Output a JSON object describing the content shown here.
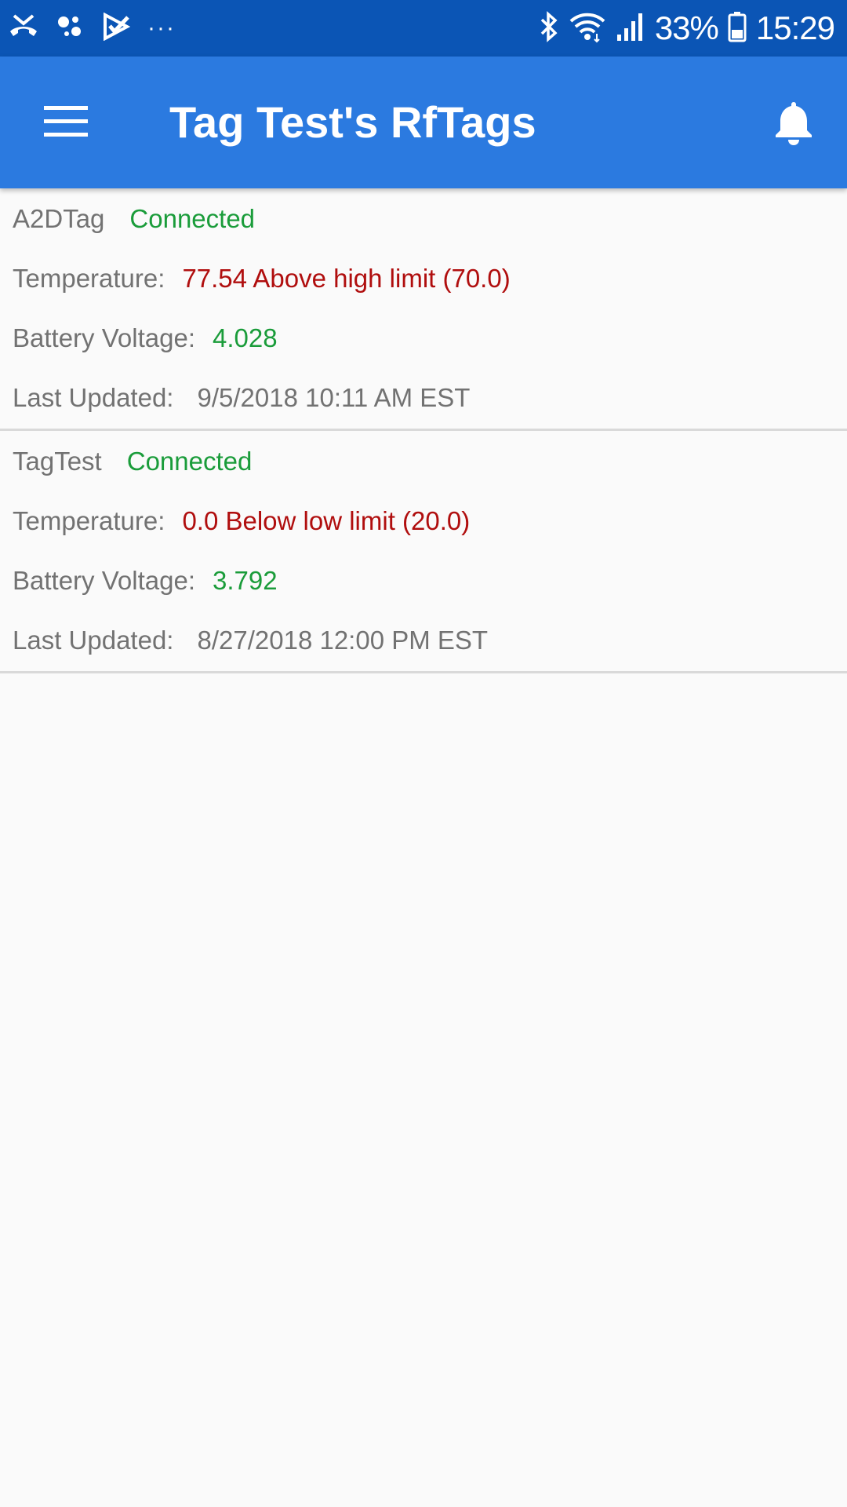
{
  "status_bar": {
    "battery_percent": "33%",
    "time": "15:29",
    "more": "···",
    "icons": [
      "missed-call-icon",
      "assistant-icon",
      "checkmark-app-icon",
      "bluetooth-icon",
      "wifi-icon",
      "signal-icon",
      "battery-icon"
    ]
  },
  "app_bar": {
    "title": "Tag Test's RfTags",
    "menu_icon": "menu-icon",
    "notification_icon": "bell-icon"
  },
  "colors": {
    "status_bar": "#0b55b5",
    "app_bar": "#2b7ae0",
    "ok": "#1a9c3a",
    "alert": "#b00e0e",
    "text": "#727272"
  },
  "tags": [
    {
      "name": "A2DTag",
      "status": "Connected",
      "temperature_label": "Temperature:",
      "temperature_value": "77.54 Above high limit (70.0)",
      "battery_label": "Battery Voltage:",
      "battery_value": "4.028",
      "updated_label": "Last Updated:",
      "updated_value": "9/5/2018 10:11 AM EST"
    },
    {
      "name": "TagTest",
      "status": "Connected",
      "temperature_label": "Temperature:",
      "temperature_value": "0.0 Below low limit (20.0)",
      "battery_label": "Battery Voltage:",
      "battery_value": "3.792",
      "updated_label": "Last Updated:",
      "updated_value": "8/27/2018 12:00 PM EST"
    }
  ]
}
